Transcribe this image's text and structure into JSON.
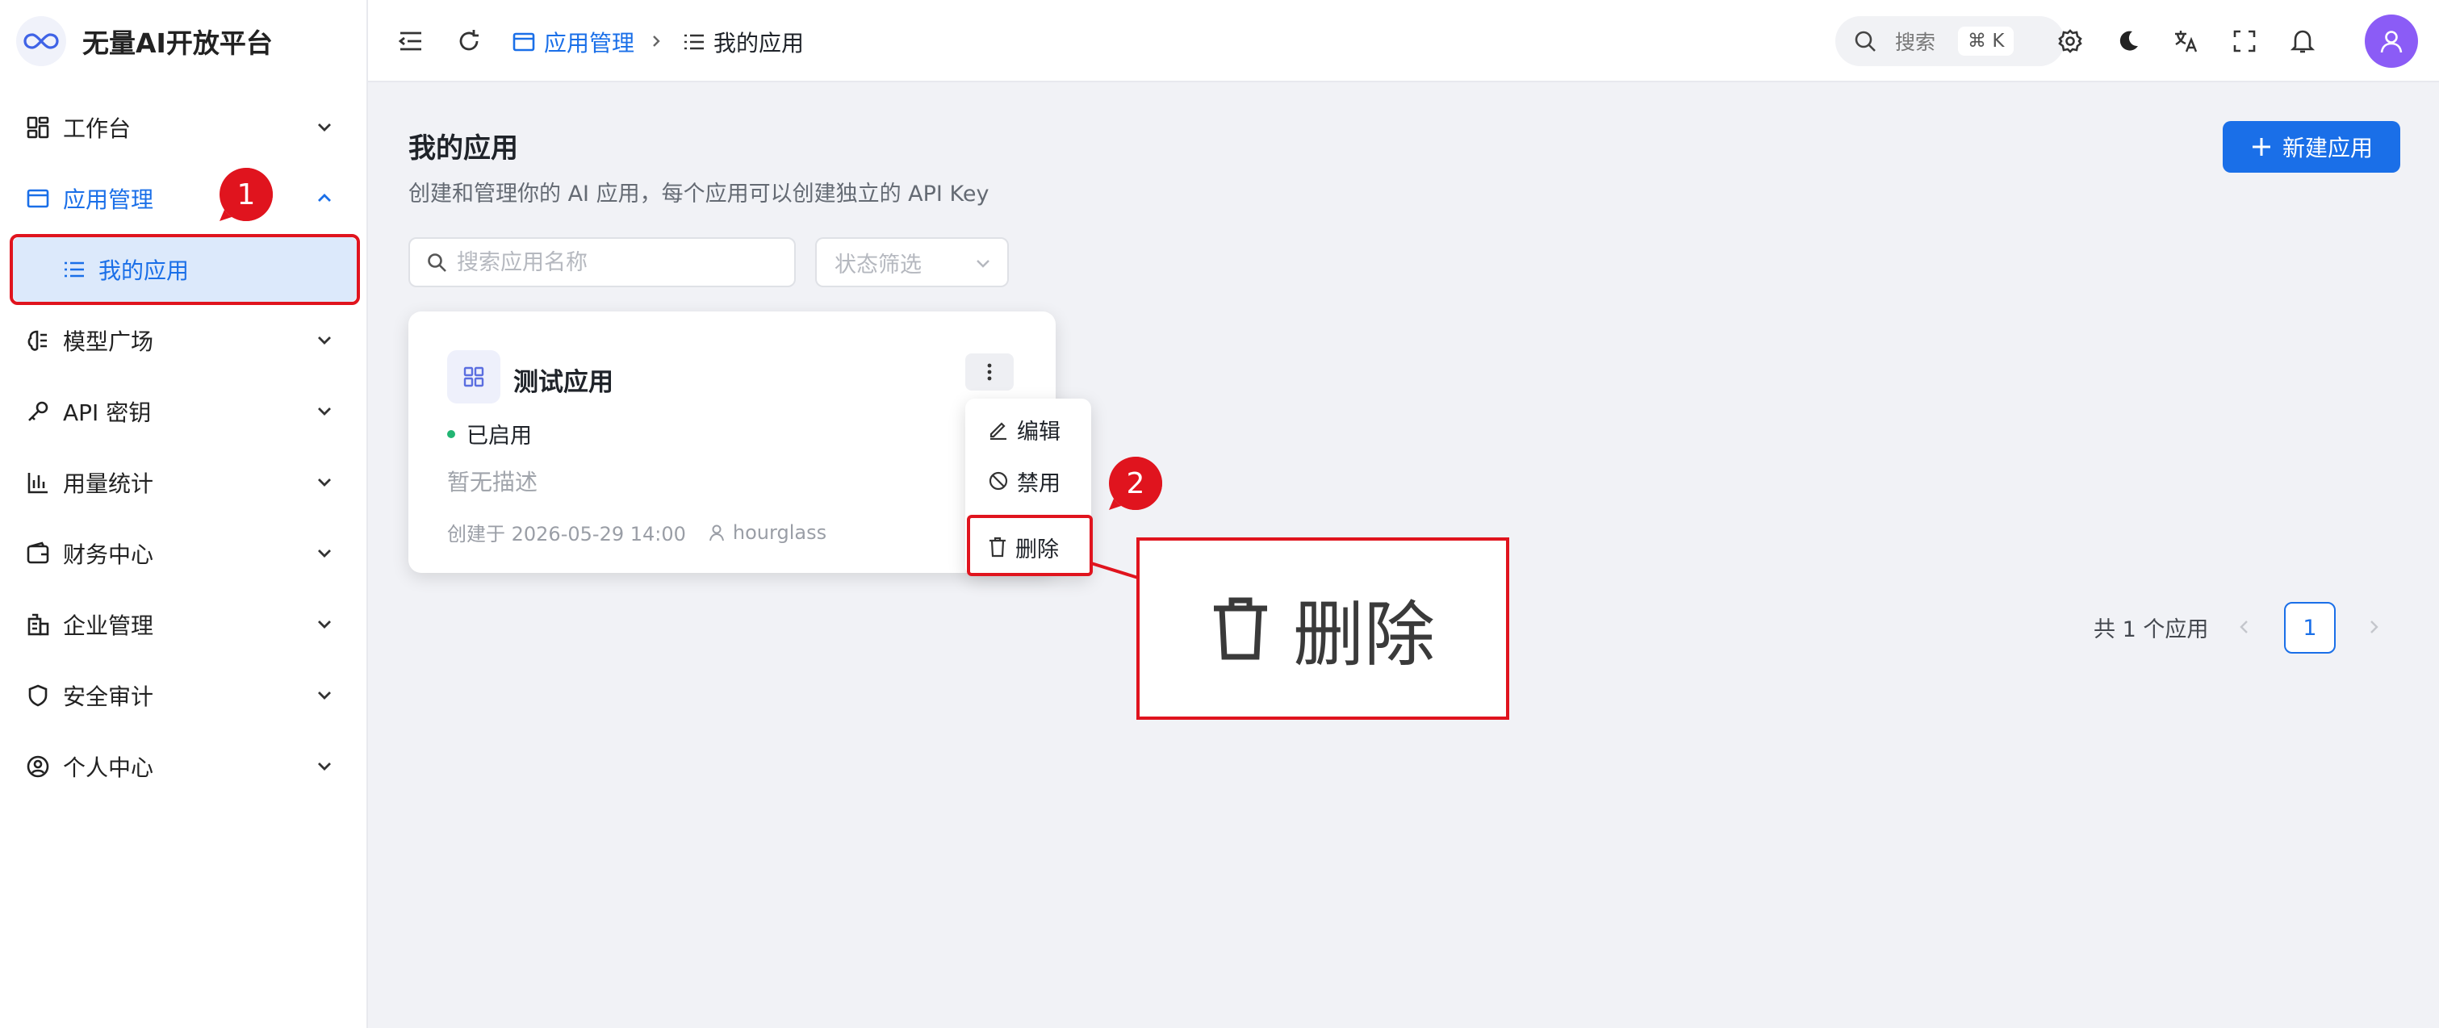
{
  "app": {
    "brand": "无量AI开放平台",
    "logo_icon": "infinity-icon"
  },
  "sidebar": {
    "items": [
      {
        "label": "工作台",
        "icon": "dashboard-grid-icon",
        "expanded": false
      },
      {
        "label": "应用管理",
        "icon": "app-window-icon",
        "expanded": true,
        "active": true,
        "children": [
          {
            "label": "我的应用",
            "icon": "list-icon",
            "selected": true
          }
        ]
      },
      {
        "label": "模型广场",
        "icon": "brain-icon",
        "expanded": false
      },
      {
        "label": "API 密钥",
        "icon": "key-icon",
        "expanded": false
      },
      {
        "label": "用量统计",
        "icon": "bar-chart-icon",
        "expanded": false
      },
      {
        "label": "财务中心",
        "icon": "wallet-icon",
        "expanded": false
      },
      {
        "label": "企业管理",
        "icon": "building-icon",
        "expanded": false
      },
      {
        "label": "安全审计",
        "icon": "shield-icon",
        "expanded": false
      },
      {
        "label": "个人中心",
        "icon": "user-circle-icon",
        "expanded": false
      }
    ]
  },
  "header": {
    "breadcrumb": [
      {
        "label": "应用管理",
        "icon": "app-window-icon"
      },
      {
        "label": "我的应用",
        "icon": "list-icon"
      }
    ],
    "search": {
      "label": "搜索",
      "shortcut": "⌘ K"
    }
  },
  "main": {
    "title": "我的应用",
    "description": "创建和管理你的 AI 应用，每个应用可以创建独立的 API Key",
    "new_button": "新建应用",
    "search_placeholder": "搜索应用名称",
    "status_filter_placeholder": "状态筛选",
    "apps": [
      {
        "name": "测试应用",
        "status": "已启用",
        "description": "暂无描述",
        "created": "创建于 2026-05-29 14:00",
        "owner": "hourglass"
      }
    ],
    "menu": {
      "edit": "编辑",
      "disable": "禁用",
      "delete": "删除"
    },
    "pagination": {
      "total_text": "共 1 个应用",
      "current": "1"
    }
  },
  "annotations": {
    "step1": "1",
    "step2": "2",
    "zoom_label": "删除"
  },
  "colors": {
    "accent": "#1a6fe8",
    "highlight": "#e0141e",
    "status_enabled": "#22b573",
    "avatar": "#8b5cf6"
  }
}
